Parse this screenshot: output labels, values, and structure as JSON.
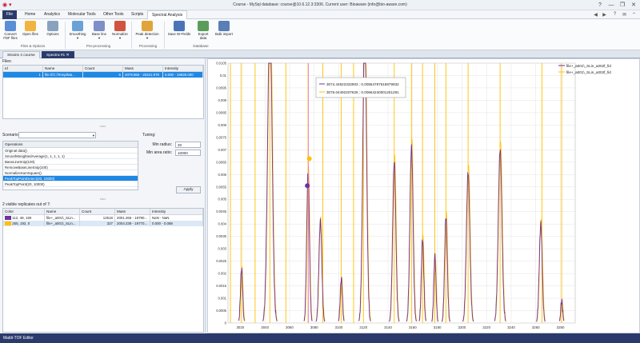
{
  "window": {
    "title": "Course - MySql database: course@10.6.12.3:3306. Current user: Bioaware (info@bio-aware.com)",
    "controls": [
      "?",
      "—",
      "❐",
      "✕"
    ]
  },
  "ribbon_tabs": [
    "File",
    "Home",
    "Analytics",
    "Molecular Tools",
    "Other Tools",
    "Scripts",
    "Spectral Analysis"
  ],
  "ribbon": {
    "buttons": [
      {
        "label": "Convert\nFDF files"
      },
      {
        "label": "Open files"
      },
      {
        "label": "Options"
      },
      {
        "label": "Smoothing\n▾"
      },
      {
        "label": "Base line\n▾"
      },
      {
        "label": "Normalize\n▾"
      },
      {
        "label": "Peak detection\n▾"
      },
      {
        "label": "Save W-Fields"
      },
      {
        "label": "Export\ndata"
      },
      {
        "label": "Bulk import"
      }
    ],
    "groups": [
      "Files & Options",
      "Pre-processing",
      "Processing",
      "Database"
    ]
  },
  "doc_tabs": [
    "Strains 4 course",
    "Spectra #1"
  ],
  "files": {
    "label": "Files:",
    "columns": [
      "Id",
      "Name",
      "Count",
      "Mass",
      "Intensity"
    ],
    "rows": [
      [
        "1",
        "file:///C:/Temp/Ma...",
        "6",
        "2079.866 - 20221.979",
        "0.000 - 19828.000"
      ]
    ]
  },
  "scenario": {
    "label": "Scenario:",
    "value": "",
    "ops_header": "Operations",
    "operations": [
      "Original data()",
      "SmoothWeightedAverage(1, 1, 1, 1, 1)",
      "BaseLineSnip(100)",
      "RemoveBaseLineSnip(100)",
      "NormalizeSumSquare()",
      "PeakTopPointDetect(20, 10000)",
      "PeakTopPoint(20, 10000)"
    ],
    "selected_index": 5
  },
  "tuning": {
    "label": "Tuning:",
    "fields": [
      {
        "label": "Min radius:",
        "value": "20"
      },
      {
        "label": "Min area ratio:",
        "value": "10000"
      }
    ],
    "apply": "Apply"
  },
  "replicates": {
    "label": "2 visible replicates out of 7:",
    "columns": [
      "Color",
      "Name",
      "Count",
      "Mass",
      "Intensity"
    ],
    "rows": [
      {
        "swatch": "#70309f",
        "color": "112, 48, 160",
        "name": "file+_a001\\_SLin...",
        "count": "12518",
        "mass": "2001.266 - 19790...",
        "intensity": "NaN - NaN"
      },
      {
        "swatch": "#ffc000",
        "color": "255, 192, 0",
        "name": "file+_a001\\_SLin...",
        "count": "327",
        "mass": "2004.239 - 19770...",
        "intensity": "0.000 - 0.088"
      }
    ]
  },
  "chart_data": {
    "type": "line",
    "legend": [
      "file+_a001\\_SLin_a002f_fid",
      "file+_a001\\_SLin_a002f_fid"
    ],
    "legend_position": "top-right",
    "colors": [
      "#70309f",
      "#ffc000"
    ],
    "tooltip": [
      "3074.44822332903 ; 0.00554787616979932",
      "3076.04492207626 ; 0.00664240001251291"
    ],
    "xlim": [
      3010,
      3292
    ],
    "ylim": [
      0,
      0.0105
    ],
    "xticks": [
      "3020",
      "3040",
      "3060",
      "3080",
      "3100",
      "3120",
      "3140",
      "3160",
      "3180",
      "3200",
      "3220",
      "3240",
      "3260",
      "3280"
    ],
    "yticks": [
      "0",
      "0.0005",
      "0.001",
      "0.0015",
      "0.002",
      "0.0025",
      "0.003",
      "0.0035",
      "0.004",
      "0.0045",
      "0.005",
      "0.0055",
      "0.006",
      "0.0065",
      "0.007",
      "0.0075",
      "0.008",
      "0.0085",
      "0.009",
      "0.0095",
      "0.01",
      "0.0105"
    ],
    "cursor_x": 3075.3,
    "marker_points": [
      {
        "x": 3074.45,
        "y": 0.00555,
        "series": 0
      },
      {
        "x": 3076.04,
        "y": 0.00664,
        "series": 1
      }
    ],
    "peak_lines": [
      3012,
      3021,
      3032,
      3044,
      3057,
      3075,
      3087,
      3102,
      3112,
      3120,
      3145,
      3159,
      3168,
      3178,
      3187,
      3205,
      3231,
      3265,
      3281
    ],
    "peaks": [
      {
        "c": 3021,
        "h": 0.0022,
        "w": 0.9
      },
      {
        "c": 3044,
        "h": 0.0125,
        "w": 1.8
      },
      {
        "c": 3075,
        "h": 0.0061,
        "w": 1.1
      },
      {
        "c": 3085,
        "h": 0.0041,
        "w": 1.2
      },
      {
        "c": 3102,
        "h": 0.0018,
        "w": 0.9
      },
      {
        "c": 3121,
        "h": 0.012,
        "w": 1.5
      },
      {
        "c": 3145,
        "h": 0.0065,
        "w": 1.3
      },
      {
        "c": 3159,
        "h": 0.0071,
        "w": 1.3
      },
      {
        "c": 3168,
        "h": 0.0034,
        "w": 1.0
      },
      {
        "c": 3178,
        "h": 0.0027,
        "w": 0.9
      },
      {
        "c": 3187,
        "h": 0.0043,
        "w": 1.1
      },
      {
        "c": 3205,
        "h": 0.0061,
        "w": 1.4
      },
      {
        "c": 3231,
        "h": 0.007,
        "w": 1.5
      },
      {
        "c": 3264,
        "h": 0.004,
        "w": 1.2
      },
      {
        "c": 3281,
        "h": 0.0009,
        "w": 0.8
      }
    ]
  },
  "status": "Maldi-TOF Editor"
}
